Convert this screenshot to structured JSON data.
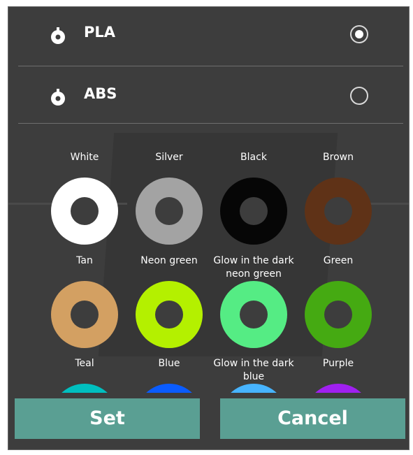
{
  "materials": [
    {
      "label": "PLA",
      "selected": true,
      "icon": "spool-icon"
    },
    {
      "label": "ABS",
      "selected": false,
      "icon": "spool-icon"
    }
  ],
  "colors": [
    {
      "label": "White",
      "hex": "#ffffff"
    },
    {
      "label": "Silver",
      "hex": "#a3a3a3"
    },
    {
      "label": "Black",
      "hex": "#060606"
    },
    {
      "label": "Brown",
      "hex": "#5f3217"
    },
    {
      "label": "Tan",
      "hex": "#d3a062"
    },
    {
      "label": "Neon green",
      "hex": "#b4f000"
    },
    {
      "label": "Glow in the dark neon green",
      "hex": "#55ec84"
    },
    {
      "label": "Green",
      "hex": "#45aa12"
    },
    {
      "label": "Teal",
      "hex": "#00bfbf"
    },
    {
      "label": "Blue",
      "hex": "#0a5cff"
    },
    {
      "label": "Glow in the dark blue",
      "hex": "#47b4ff"
    },
    {
      "label": "Purple",
      "hex": "#a020f0"
    }
  ],
  "buttons": {
    "set_label": "Set",
    "cancel_label": "Cancel",
    "accent": "#5a9f93"
  }
}
